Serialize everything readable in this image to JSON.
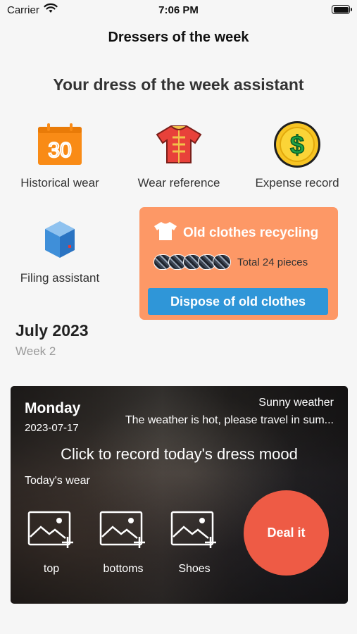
{
  "status_bar": {
    "carrier": "Carrier",
    "time": "7:06 PM",
    "battery_level": 1.0
  },
  "nav": {
    "title": "Dressers of the week"
  },
  "subtitle": "Your dress of the week assistant",
  "features": [
    {
      "label": "Historical wear",
      "icon": "calendar-icon",
      "icon_text": "30"
    },
    {
      "label": "Wear reference",
      "icon": "shirt-icon"
    },
    {
      "label": "Expense record",
      "icon": "dollar-coin-icon"
    },
    {
      "label": "Filing assistant",
      "icon": "box-icon"
    }
  ],
  "recycling": {
    "title": "Old clothes recycling",
    "icon": "tshirt-icon",
    "pieces": "Total 24 pieces",
    "button": "Dispose of old clothes"
  },
  "calendar": {
    "month": "July 2023",
    "week": "Week 2"
  },
  "dress_card": {
    "day": "Monday",
    "date": "2023-07-17",
    "weather": "Sunny weather",
    "weather_desc": "The weather is hot, please travel in sum...",
    "record_prompt": "Click to record today's dress mood",
    "todays_wear": "Today's wear",
    "slots": [
      {
        "label": "top",
        "icon": "add-image-icon"
      },
      {
        "label": "bottoms",
        "icon": "add-image-icon"
      },
      {
        "label": "Shoes",
        "icon": "add-image-icon"
      }
    ],
    "deal_button": "Deal it"
  },
  "colors": {
    "background": "#f6f6f6",
    "card_orange": "#fd9866",
    "button_blue": "#2f96d8",
    "deal_red": "#ee5b45",
    "calendar_orange": "#f98b16"
  }
}
